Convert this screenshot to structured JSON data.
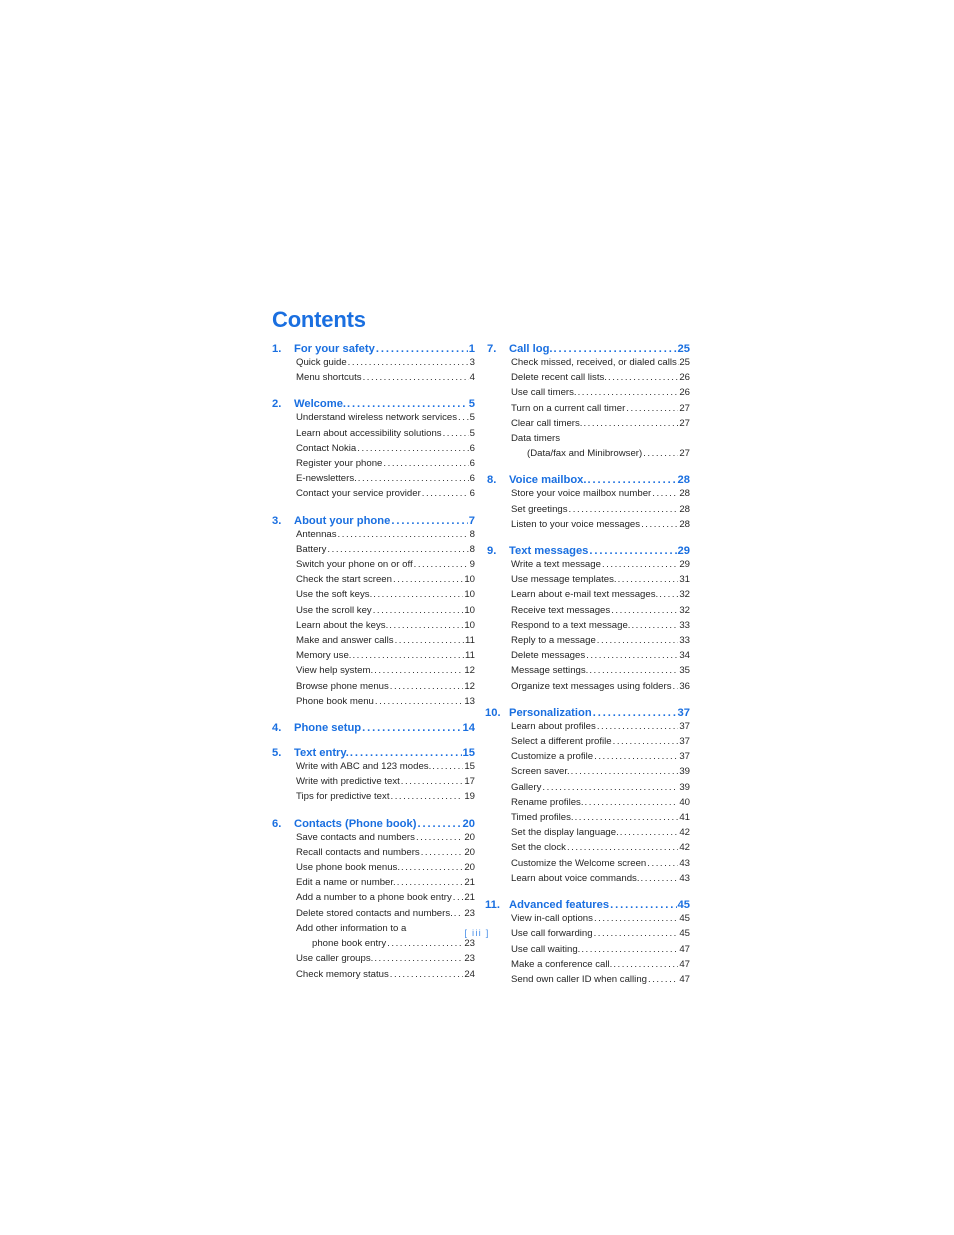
{
  "page": {
    "heading": "Contents",
    "page_marker": "[ iii ]",
    "accent_color": "#1a6fe0",
    "body_color": "#262626",
    "marker_color": "#4a90e8",
    "background": "#ffffff"
  },
  "columns": [
    {
      "id": "left",
      "sections": [
        {
          "number": "1.",
          "title": "For your safety",
          "page": "1",
          "entries": [
            {
              "text": "Quick guide",
              "page": "3"
            },
            {
              "text": "Menu shortcuts",
              "page": "4"
            }
          ]
        },
        {
          "number": "2.",
          "title": "Welcome.",
          "page": "5",
          "entries": [
            {
              "text": "Understand wireless network services",
              "page": "5"
            },
            {
              "text": "Learn about accessibility solutions",
              "page": "5"
            },
            {
              "text": "Contact Nokia",
              "page": "6"
            },
            {
              "text": "Register your phone",
              "page": "6"
            },
            {
              "text": "E-newsletters.",
              "page": "6"
            },
            {
              "text": "Contact your service provider",
              "page": "6"
            }
          ]
        },
        {
          "number": "3.",
          "title": "About your phone",
          "page": "7",
          "entries": [
            {
              "text": "Antennas",
              "page": "8"
            },
            {
              "text": "Battery",
              "page": "8"
            },
            {
              "text": "Switch your phone on or off",
              "page": "9"
            },
            {
              "text": "Check the start screen",
              "page": "10"
            },
            {
              "text": "Use the soft keys.",
              "page": "10"
            },
            {
              "text": "Use the scroll key",
              "page": "10"
            },
            {
              "text": "Learn about the keys.",
              "page": "10"
            },
            {
              "text": "Make and answer calls",
              "page": "11"
            },
            {
              "text": "Memory use.",
              "page": "11"
            },
            {
              "text": "View help system.",
              "page": "12"
            },
            {
              "text": "Browse phone menus",
              "page": "12"
            },
            {
              "text": "Phone book menu",
              "page": "13"
            }
          ]
        },
        {
          "number": "4.",
          "title": "Phone setup",
          "page": "14",
          "entries": []
        },
        {
          "number": "5.",
          "title": "Text entry.",
          "page": "15",
          "entries": [
            {
              "text": "Write with ABC and 123 modes.",
              "page": "15"
            },
            {
              "text": "Write with predictive text",
              "page": "17"
            },
            {
              "text": "Tips for predictive text",
              "page": "19"
            }
          ]
        },
        {
          "number": "6.",
          "title": "Contacts (Phone book)",
          "page": "20",
          "entries": [
            {
              "text": "Save contacts and numbers",
              "page": "20"
            },
            {
              "text": "Recall contacts and numbers",
              "page": "20"
            },
            {
              "text": "Use phone book menus.",
              "page": "20"
            },
            {
              "text": "Edit a name or number.",
              "page": "21"
            },
            {
              "text": "Add a number to a phone book entry",
              "page": "21"
            },
            {
              "text": "Delete stored contacts and numbers.",
              "page": "23"
            },
            {
              "text": "Add other information to a",
              "page": "",
              "style": "plain"
            },
            {
              "text": "phone book entry",
              "page": "23",
              "style": "cont"
            },
            {
              "text": "Use caller groups.",
              "page": "23"
            },
            {
              "text": "Check memory status",
              "page": "24"
            }
          ]
        }
      ]
    },
    {
      "id": "right",
      "sections": [
        {
          "number": "7.",
          "title": "Call log.",
          "page": "25",
          "entries": [
            {
              "text": "Check missed, received, or dialed calls",
              "page": "25"
            },
            {
              "text": "Delete recent call lists.",
              "page": "26"
            },
            {
              "text": "Use call timers.",
              "page": "26"
            },
            {
              "text": "Turn on a current call timer",
              "page": "27"
            },
            {
              "text": "Clear call timers.",
              "page": "27"
            },
            {
              "text": "Data timers",
              "page": "",
              "style": "plain"
            },
            {
              "text": "(Data/fax and Minibrowser)",
              "page": "27",
              "style": "cont"
            }
          ]
        },
        {
          "number": "8.",
          "title": "Voice mailbox.",
          "page": "28",
          "entries": [
            {
              "text": "Store your voice mailbox number",
              "page": "28"
            },
            {
              "text": "Set greetings",
              "page": "28"
            },
            {
              "text": "Listen to your voice messages",
              "page": "28"
            }
          ]
        },
        {
          "number": "9.",
          "title": "Text messages",
          "page": "29",
          "entries": [
            {
              "text": "Write a text message",
              "page": "29"
            },
            {
              "text": "Use message templates.",
              "page": "31"
            },
            {
              "text": "Learn about e-mail text messages.",
              "page": "32"
            },
            {
              "text": "Receive text messages",
              "page": "32"
            },
            {
              "text": "Respond to a text message.",
              "page": "33"
            },
            {
              "text": "Reply to a message",
              "page": "33"
            },
            {
              "text": "Delete messages",
              "page": "34"
            },
            {
              "text": "Message settings.",
              "page": "35"
            },
            {
              "text": "Organize text messages using folders",
              "page": "36"
            }
          ]
        },
        {
          "number": "10.",
          "title": "Personalization",
          "page": "37",
          "wide_number": true,
          "entries": [
            {
              "text": "Learn about profiles",
              "page": "37"
            },
            {
              "text": "Select a different profile",
              "page": "37"
            },
            {
              "text": "Customize a profile",
              "page": "37"
            },
            {
              "text": "Screen saver.",
              "page": "39"
            },
            {
              "text": "Gallery",
              "page": "39"
            },
            {
              "text": "Rename profiles.",
              "page": "40"
            },
            {
              "text": "Timed profiles.",
              "page": "41"
            },
            {
              "text": "Set the display language.",
              "page": "42"
            },
            {
              "text": "Set the clock",
              "page": "42"
            },
            {
              "text": "Customize the Welcome screen",
              "page": "43"
            },
            {
              "text": "Learn about voice commands.",
              "page": "43"
            }
          ]
        },
        {
          "number": "11.",
          "title": "Advanced features",
          "page": "45",
          "wide_number": true,
          "entries": [
            {
              "text": "View in-call options",
              "page": "45"
            },
            {
              "text": "Use call forwarding",
              "page": "45"
            },
            {
              "text": "Use call waiting.",
              "page": "47"
            },
            {
              "text": "Make a conference call.",
              "page": "47"
            },
            {
              "text": "Send own caller ID when calling",
              "page": "47"
            }
          ]
        }
      ]
    }
  ]
}
